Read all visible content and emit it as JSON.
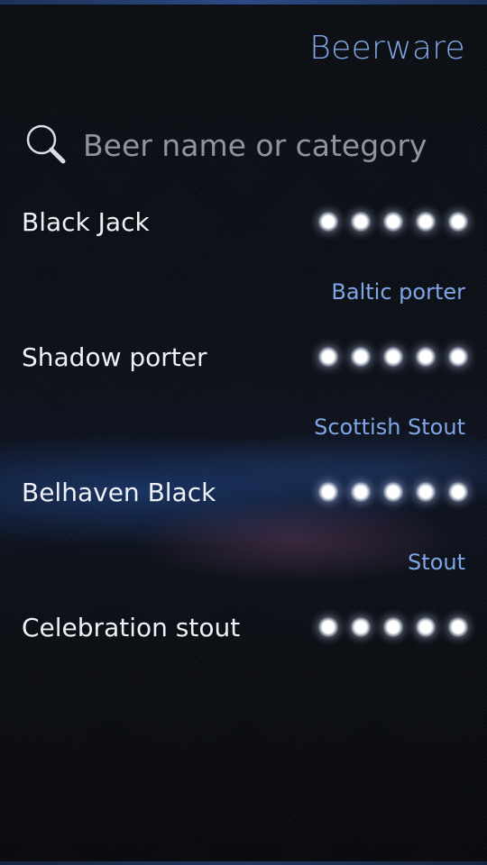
{
  "app": {
    "title": "Beerware"
  },
  "search": {
    "placeholder": "Beer name or category",
    "value": ""
  },
  "beers": [
    {
      "name": "Black Jack",
      "category": "Baltic porter",
      "rating": 5
    },
    {
      "name": "Shadow porter",
      "category": "Scottish Stout",
      "rating": 5
    },
    {
      "name": "Belhaven Black",
      "category": "Stout",
      "rating": 5
    },
    {
      "name": "Celebration stout",
      "category": "",
      "rating": 5
    }
  ],
  "colors": {
    "accent": "#7fa6e6",
    "text": "#eef2f7",
    "background": "#0a0d12"
  }
}
